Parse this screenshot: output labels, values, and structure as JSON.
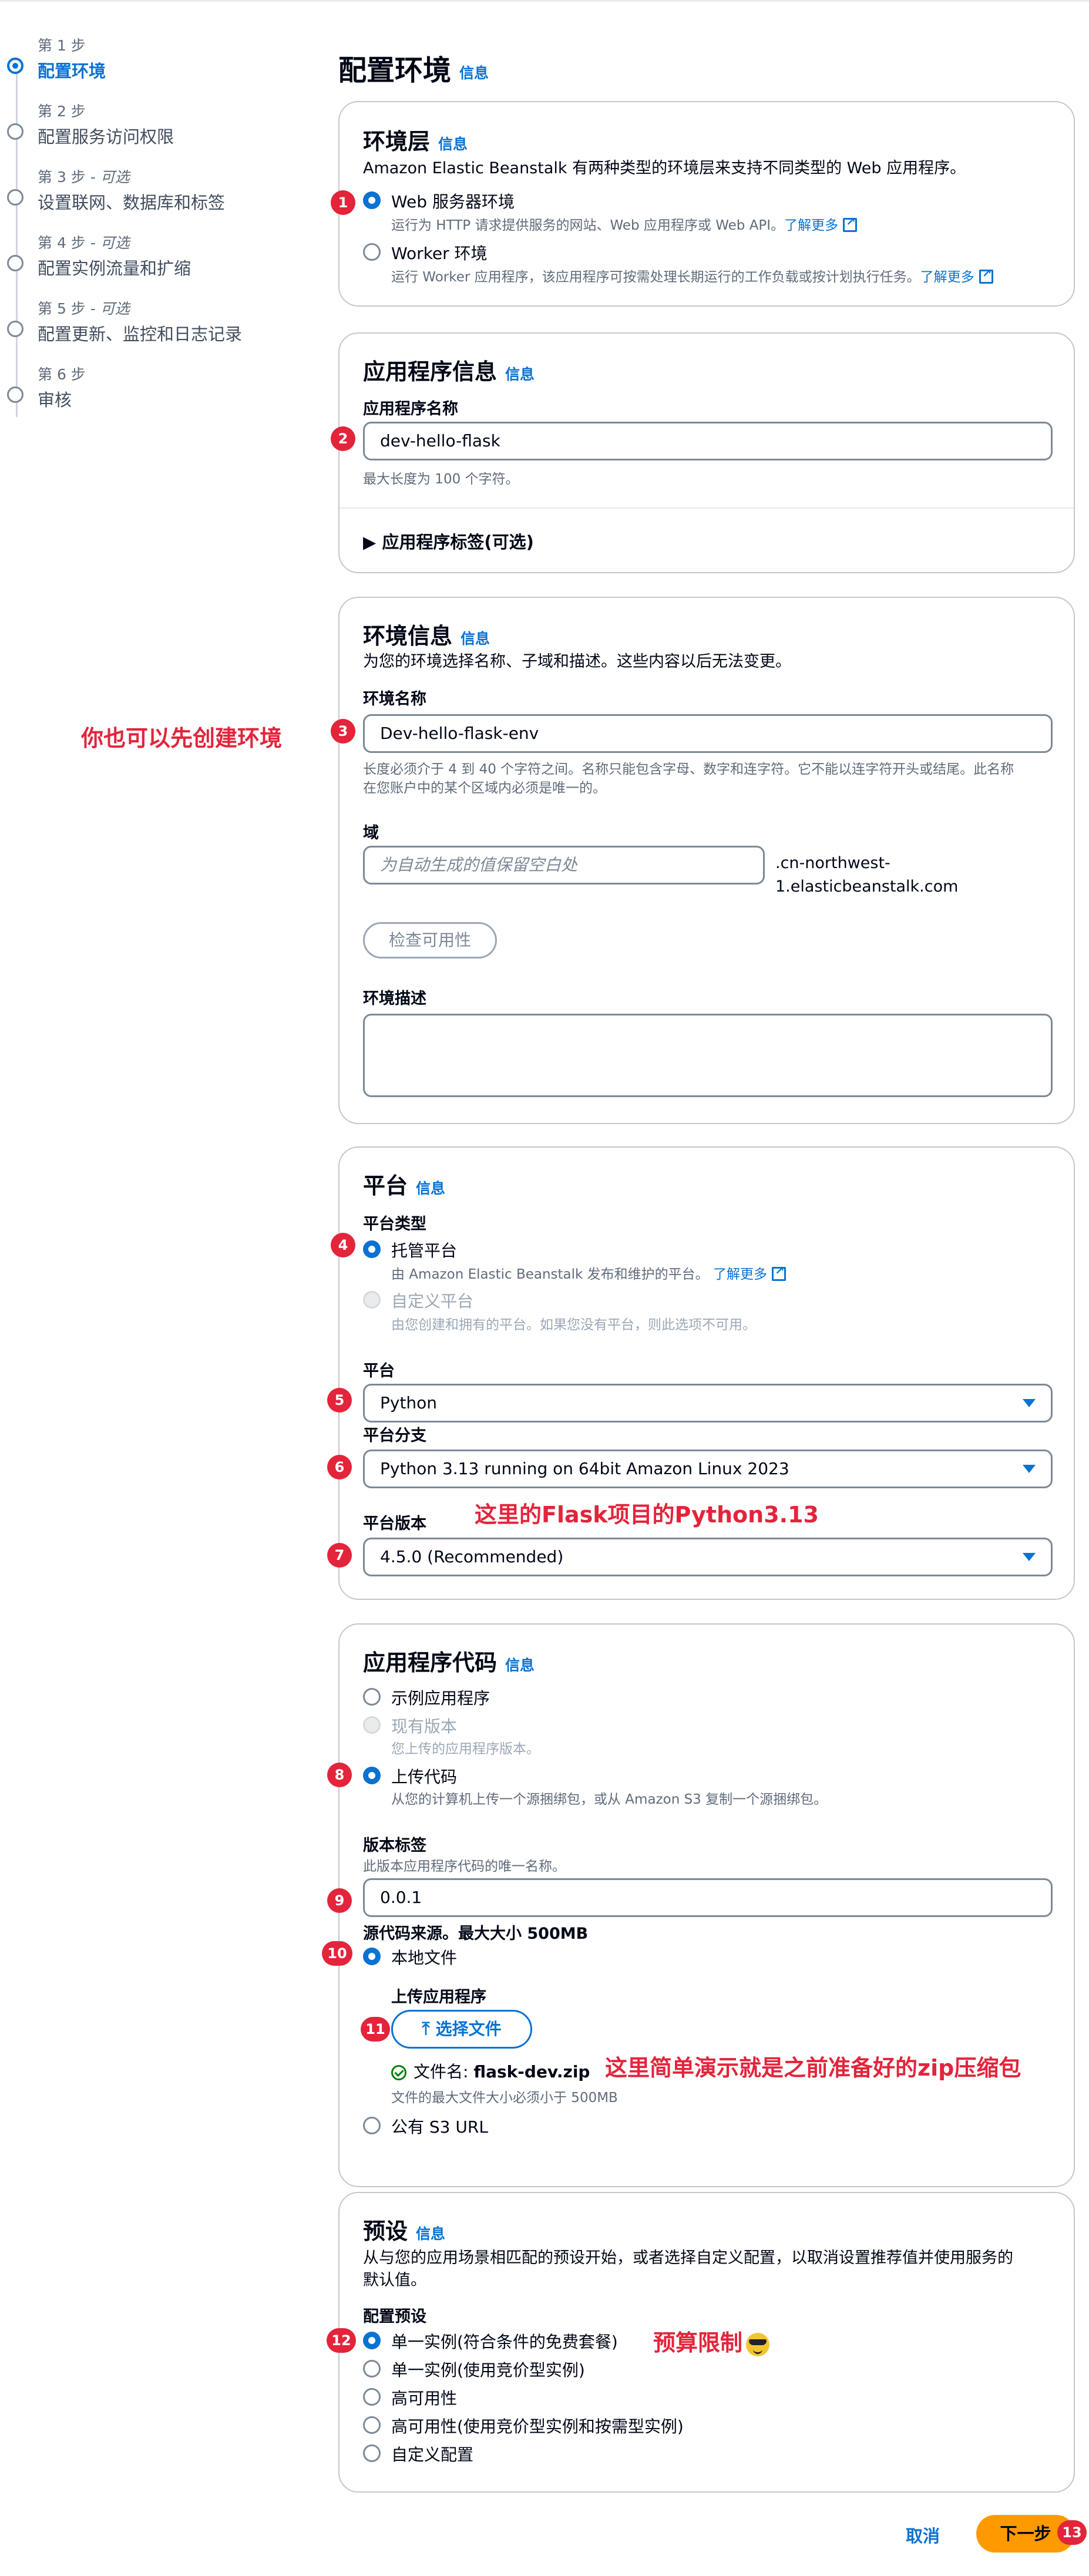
{
  "stepper": {
    "steps": [
      {
        "number": "第 1 步",
        "optional": "",
        "title": "配置环境"
      },
      {
        "number": "第 2 步",
        "optional": "",
        "title": "配置服务访问权限"
      },
      {
        "number": "第 3 步 - ",
        "optional": "可选",
        "title": "设置联网、数据库和标签"
      },
      {
        "number": "第 4 步 - ",
        "optional": "可选",
        "title": "配置实例流量和扩缩"
      },
      {
        "number": "第 5 步 - ",
        "optional": "可选",
        "title": "配置更新、监控和日志记录"
      },
      {
        "number": "第 6 步",
        "optional": "",
        "title": "审核"
      }
    ]
  },
  "page": {
    "title": "配置环境",
    "info": "信息"
  },
  "tier": {
    "title": "环境层",
    "info": "信息",
    "description": "Amazon Elastic Beanstalk 有两种类型的环境层来支持不同类型的 Web 应用程序。",
    "options": [
      {
        "label": "Web 服务器环境",
        "desc": "运行为 HTTP 请求提供服务的网站、Web 应用程序或 Web API。",
        "link": "了解更多",
        "selected": true
      },
      {
        "label": "Worker 环境",
        "desc": "运行 Worker 应用程序，该应用程序可按需处理长期运行的工作负载或按计划执行任务。",
        "link": "了解更多",
        "selected": false
      }
    ]
  },
  "app_info": {
    "title": "应用程序信息",
    "info": "信息",
    "name_label": "应用程序名称",
    "name_value": "dev-hello-flask",
    "name_hint": "最大长度为 100 个字符。",
    "tags_toggle": "▶  应用程序标签(可选)"
  },
  "env_info": {
    "title": "环境信息",
    "info": "信息",
    "description": "为您的环境选择名称、子域和描述。这些内容以后无法变更。",
    "name_label": "环境名称",
    "name_value": "Dev-hello-flask-env",
    "name_hint_1": "长度必须介于 4 到 40 个字符之间。名称只能包含字母、数字和连字符。它不能以连字符开头或结尾。此名称",
    "name_hint_2": "在您账户中的某个区域内必须是唯一的。",
    "domain_label": "域",
    "domain_placeholder": "为自动生成的值保留空白处",
    "domain_suffix_1": ".cn-northwest-",
    "domain_suffix_2": "1.elasticbeanstalk.com",
    "check_button": "检查可用性",
    "desc_label": "环境描述"
  },
  "platform": {
    "title": "平台",
    "info": "信息",
    "type_label": "平台类型",
    "managed_label": "托管平台",
    "managed_desc": "由 Amazon Elastic Beanstalk 发布和维护的平台。",
    "managed_link": "了解更多",
    "custom_label": "自定义平台",
    "custom_desc": "由您创建和拥有的平台。如果您没有平台，则此选项不可用。",
    "platform_label": "平台",
    "platform_value": "Python",
    "branch_label": "平台分支",
    "branch_value": "Python 3.13 running on 64bit Amazon Linux 2023",
    "version_label": "平台版本",
    "version_value": "4.5.0 (Recommended)"
  },
  "app_code": {
    "title": "应用程序代码",
    "info": "信息",
    "sample_label": "示例应用程序",
    "existing_label": "现有版本",
    "existing_desc": "您上传的应用程序版本。",
    "upload_label": "上传代码",
    "upload_desc": "从您的计算机上传一个源捆绑包，或从 Amazon S3 复制一个源捆绑包。",
    "version_label_title": "版本标签",
    "version_label_desc": "此版本应用程序代码的唯一名称。",
    "version_value": "0.0.1",
    "source_label": "源代码来源。最大大小 500MB",
    "local_label": "本地文件",
    "upload_app_label": "上传应用程序",
    "choose_file": "选择文件",
    "file_name_prefix": "文件名: ",
    "file_name": "flask-dev.zip",
    "file_hint": "文件的最大文件大小必须小于 500MB",
    "s3_label": "公有 S3 URL"
  },
  "presets": {
    "title": "预设",
    "info": "信息",
    "description_1": "从与您的应用场景相匹配的预设开始，或者选择自定义配置，以取消设置推荐值并使用服务的",
    "description_2": "默认值。",
    "config_label": "配置预设",
    "options": [
      {
        "label": "单一实例(符合条件的免费套餐)",
        "selected": true
      },
      {
        "label": "单一实例(使用竞价型实例)",
        "selected": false
      },
      {
        "label": "高可用性",
        "selected": false
      },
      {
        "label": "高可用性(使用竞价型实例和按需型实例)",
        "selected": false
      },
      {
        "label": "自定义配置",
        "selected": false
      }
    ]
  },
  "footer": {
    "cancel": "取消",
    "next": "下一步"
  },
  "annotations": {
    "env_first": "你也可以先创建环境",
    "python_note": "这里的Flask项目的Python3.13",
    "zip_note": "这里简单演示就是之前准备好的zip压缩包",
    "budget_note": "预算限制"
  },
  "badges": [
    "1",
    "2",
    "3",
    "4",
    "5",
    "6",
    "7",
    "8",
    "9",
    "10",
    "11",
    "12",
    "13"
  ],
  "colors": {
    "accent": "#0972d3",
    "annotation": "#e3243b",
    "next_button": "#ff9900",
    "success": "#037f0c"
  }
}
